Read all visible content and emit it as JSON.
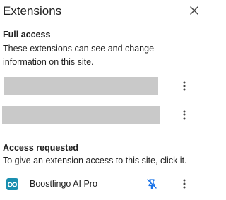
{
  "header": {
    "title": "Extensions",
    "close_icon": "close-icon"
  },
  "full_access": {
    "heading": "Full access",
    "description_line1": "These extensions can see and change",
    "description_line2": "information on this site.",
    "items": [
      {
        "name": "",
        "redacted": true,
        "menu_icon": "more-vert-icon"
      },
      {
        "name": "",
        "redacted": true,
        "menu_icon": "more-vert-icon"
      }
    ]
  },
  "access_requested": {
    "heading": "Access requested",
    "description": "To give an extension access to this site, click it.",
    "items": [
      {
        "name": "Boostlingo AI Pro",
        "icon": "boostlingo-logo-icon",
        "pin_icon": "pin-off-icon",
        "menu_icon": "more-vert-icon"
      }
    ]
  },
  "colors": {
    "text": "#1f1f1f",
    "redacted": "#c9c9c9",
    "pin_accent": "#1a73e8",
    "boostlingo_brand": "#1a8fb0"
  }
}
